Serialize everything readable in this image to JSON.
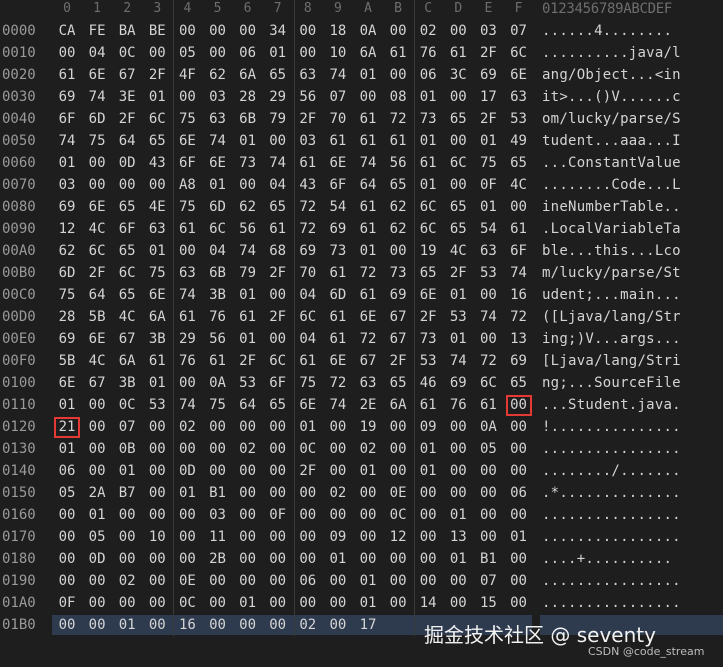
{
  "header": {
    "columns": [
      "0",
      "1",
      "2",
      "3",
      "4",
      "5",
      "6",
      "7",
      "8",
      "9",
      "A",
      "B",
      "C",
      "D",
      "E",
      "F"
    ],
    "ascii_label": "0123456789ABCDEF"
  },
  "rows": [
    {
      "addr": "0000",
      "bytes": [
        "CA",
        "FE",
        "BA",
        "BE",
        "00",
        "00",
        "00",
        "34",
        "00",
        "18",
        "0A",
        "00",
        "02",
        "00",
        "03",
        "07"
      ],
      "ascii": "......4........"
    },
    {
      "addr": "0010",
      "bytes": [
        "00",
        "04",
        "0C",
        "00",
        "05",
        "00",
        "06",
        "01",
        "00",
        "10",
        "6A",
        "61",
        "76",
        "61",
        "2F",
        "6C"
      ],
      "ascii": "..........java/l"
    },
    {
      "addr": "0020",
      "bytes": [
        "61",
        "6E",
        "67",
        "2F",
        "4F",
        "62",
        "6A",
        "65",
        "63",
        "74",
        "01",
        "00",
        "06",
        "3C",
        "69",
        "6E"
      ],
      "ascii": "ang/Object...<in"
    },
    {
      "addr": "0030",
      "bytes": [
        "69",
        "74",
        "3E",
        "01",
        "00",
        "03",
        "28",
        "29",
        "56",
        "07",
        "00",
        "08",
        "01",
        "00",
        "17",
        "63"
      ],
      "ascii": "it>...()V......c"
    },
    {
      "addr": "0040",
      "bytes": [
        "6F",
        "6D",
        "2F",
        "6C",
        "75",
        "63",
        "6B",
        "79",
        "2F",
        "70",
        "61",
        "72",
        "73",
        "65",
        "2F",
        "53"
      ],
      "ascii": "om/lucky/parse/S"
    },
    {
      "addr": "0050",
      "bytes": [
        "74",
        "75",
        "64",
        "65",
        "6E",
        "74",
        "01",
        "00",
        "03",
        "61",
        "61",
        "61",
        "01",
        "00",
        "01",
        "49"
      ],
      "ascii": "tudent...aaa...I"
    },
    {
      "addr": "0060",
      "bytes": [
        "01",
        "00",
        "0D",
        "43",
        "6F",
        "6E",
        "73",
        "74",
        "61",
        "6E",
        "74",
        "56",
        "61",
        "6C",
        "75",
        "65"
      ],
      "ascii": "...ConstantValue"
    },
    {
      "addr": "0070",
      "bytes": [
        "03",
        "00",
        "00",
        "00",
        "A8",
        "01",
        "00",
        "04",
        "43",
        "6F",
        "64",
        "65",
        "01",
        "00",
        "0F",
        "4C"
      ],
      "ascii": "........Code...L"
    },
    {
      "addr": "0080",
      "bytes": [
        "69",
        "6E",
        "65",
        "4E",
        "75",
        "6D",
        "62",
        "65",
        "72",
        "54",
        "61",
        "62",
        "6C",
        "65",
        "01",
        "00"
      ],
      "ascii": "ineNumberTable.."
    },
    {
      "addr": "0090",
      "bytes": [
        "12",
        "4C",
        "6F",
        "63",
        "61",
        "6C",
        "56",
        "61",
        "72",
        "69",
        "61",
        "62",
        "6C",
        "65",
        "54",
        "61"
      ],
      "ascii": ".LocalVariableTa"
    },
    {
      "addr": "00A0",
      "bytes": [
        "62",
        "6C",
        "65",
        "01",
        "00",
        "04",
        "74",
        "68",
        "69",
        "73",
        "01",
        "00",
        "19",
        "4C",
        "63",
        "6F"
      ],
      "ascii": "ble...this...Lco"
    },
    {
      "addr": "00B0",
      "bytes": [
        "6D",
        "2F",
        "6C",
        "75",
        "63",
        "6B",
        "79",
        "2F",
        "70",
        "61",
        "72",
        "73",
        "65",
        "2F",
        "53",
        "74"
      ],
      "ascii": "m/lucky/parse/St"
    },
    {
      "addr": "00C0",
      "bytes": [
        "75",
        "64",
        "65",
        "6E",
        "74",
        "3B",
        "01",
        "00",
        "04",
        "6D",
        "61",
        "69",
        "6E",
        "01",
        "00",
        "16"
      ],
      "ascii": "udent;...main..."
    },
    {
      "addr": "00D0",
      "bytes": [
        "28",
        "5B",
        "4C",
        "6A",
        "61",
        "76",
        "61",
        "2F",
        "6C",
        "61",
        "6E",
        "67",
        "2F",
        "53",
        "74",
        "72"
      ],
      "ascii": "([Ljava/lang/Str"
    },
    {
      "addr": "00E0",
      "bytes": [
        "69",
        "6E",
        "67",
        "3B",
        "29",
        "56",
        "01",
        "00",
        "04",
        "61",
        "72",
        "67",
        "73",
        "01",
        "00",
        "13"
      ],
      "ascii": "ing;)V...args..."
    },
    {
      "addr": "00F0",
      "bytes": [
        "5B",
        "4C",
        "6A",
        "61",
        "76",
        "61",
        "2F",
        "6C",
        "61",
        "6E",
        "67",
        "2F",
        "53",
        "74",
        "72",
        "69"
      ],
      "ascii": "[Ljava/lang/Stri"
    },
    {
      "addr": "0100",
      "bytes": [
        "6E",
        "67",
        "3B",
        "01",
        "00",
        "0A",
        "53",
        "6F",
        "75",
        "72",
        "63",
        "65",
        "46",
        "69",
        "6C",
        "65"
      ],
      "ascii": "ng;...SourceFile"
    },
    {
      "addr": "0110",
      "bytes": [
        "01",
        "00",
        "0C",
        "53",
        "74",
        "75",
        "64",
        "65",
        "6E",
        "74",
        "2E",
        "6A",
        "61",
        "76",
        "61",
        "00"
      ],
      "ascii": "...Student.java."
    },
    {
      "addr": "0120",
      "bytes": [
        "21",
        "00",
        "07",
        "00",
        "02",
        "00",
        "00",
        "00",
        "01",
        "00",
        "19",
        "00",
        "09",
        "00",
        "0A",
        "00"
      ],
      "ascii": "!..............."
    },
    {
      "addr": "0130",
      "bytes": [
        "01",
        "00",
        "0B",
        "00",
        "00",
        "00",
        "02",
        "00",
        "0C",
        "00",
        "02",
        "00",
        "01",
        "00",
        "05",
        "00"
      ],
      "ascii": "................"
    },
    {
      "addr": "0140",
      "bytes": [
        "06",
        "00",
        "01",
        "00",
        "0D",
        "00",
        "00",
        "00",
        "2F",
        "00",
        "01",
        "00",
        "01",
        "00",
        "00",
        "00"
      ],
      "ascii": "......../......."
    },
    {
      "addr": "0150",
      "bytes": [
        "05",
        "2A",
        "B7",
        "00",
        "01",
        "B1",
        "00",
        "00",
        "00",
        "02",
        "00",
        "0E",
        "00",
        "00",
        "00",
        "06"
      ],
      "ascii": ".*.............."
    },
    {
      "addr": "0160",
      "bytes": [
        "00",
        "01",
        "00",
        "00",
        "00",
        "03",
        "00",
        "0F",
        "00",
        "00",
        "00",
        "0C",
        "00",
        "01",
        "00",
        "00"
      ],
      "ascii": "................"
    },
    {
      "addr": "0170",
      "bytes": [
        "00",
        "05",
        "00",
        "10",
        "00",
        "11",
        "00",
        "00",
        "00",
        "09",
        "00",
        "12",
        "00",
        "13",
        "00",
        "01"
      ],
      "ascii": "................"
    },
    {
      "addr": "0180",
      "bytes": [
        "00",
        "0D",
        "00",
        "00",
        "00",
        "2B",
        "00",
        "00",
        "00",
        "01",
        "00",
        "00",
        "00",
        "01",
        "B1",
        "00"
      ],
      "ascii": "....+.........."
    },
    {
      "addr": "0190",
      "bytes": [
        "00",
        "00",
        "02",
        "00",
        "0E",
        "00",
        "00",
        "00",
        "06",
        "00",
        "01",
        "00",
        "00",
        "00",
        "07",
        "00"
      ],
      "ascii": "................"
    },
    {
      "addr": "01A0",
      "bytes": [
        "0F",
        "00",
        "00",
        "00",
        "0C",
        "00",
        "01",
        "00",
        "00",
        "00",
        "01",
        "00",
        "14",
        "00",
        "15",
        "00"
      ],
      "ascii": "................"
    },
    {
      "addr": "01B0",
      "bytes": [
        "00",
        "00",
        "01",
        "00",
        "16",
        "00",
        "00",
        "00",
        "02",
        "00",
        "17"
      ],
      "ascii": ""
    }
  ],
  "watermark": "掘金技术社区 @ seventy",
  "credit": "CSDN @code_stream",
  "colors": {
    "background": "#1e1e1e",
    "text": "#d4d4d4",
    "address": "#9a9a9a",
    "selection": "#2e3b4f",
    "marker": "#e53935"
  }
}
